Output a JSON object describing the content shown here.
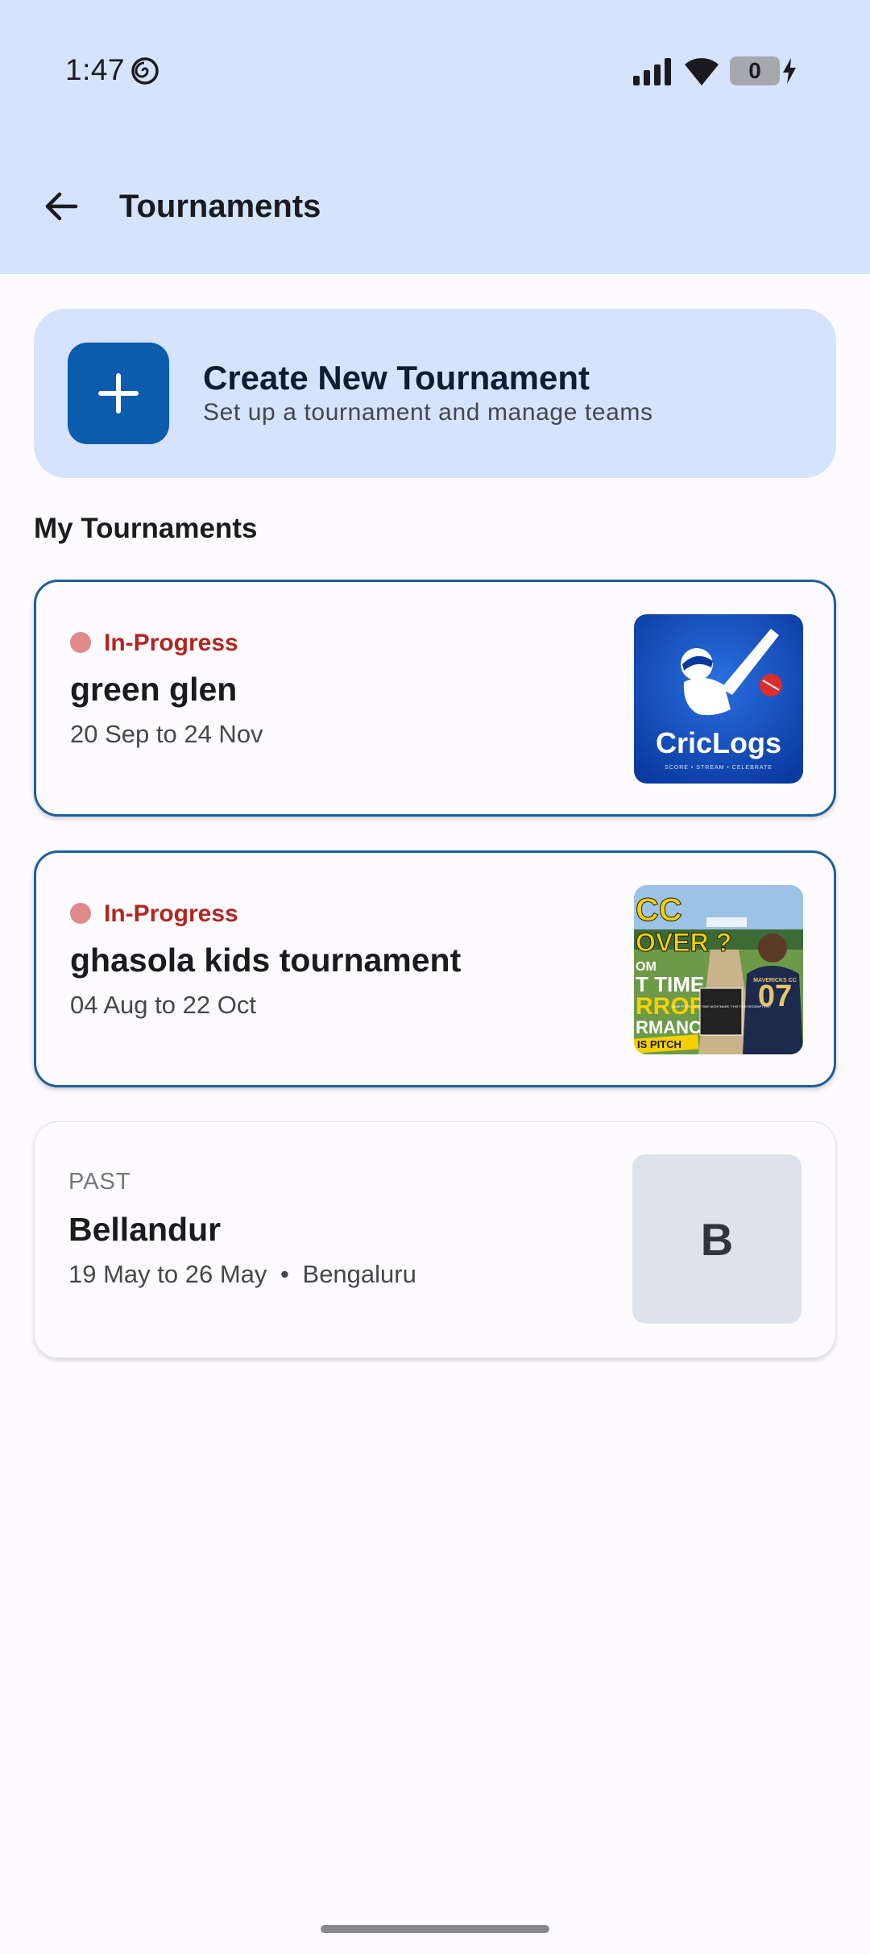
{
  "status_bar": {
    "time": "1:47",
    "battery": "0",
    "icons": [
      "spiral-icon",
      "signal-icon",
      "wifi-icon",
      "battery-icon",
      "charging-bolt-icon"
    ]
  },
  "header": {
    "title": "Tournaments",
    "back_icon": "arrow-left-icon",
    "background": "#d6e3fd"
  },
  "create": {
    "title": "Create New Tournament",
    "subtitle": "Set up a tournament and manage teams",
    "icon": "plus-icon",
    "accent": "#0b5cad"
  },
  "section_title": "My Tournaments",
  "tournaments": [
    {
      "status": "In-Progress",
      "name": "green glen",
      "dates": "20 Sep to 24 Nov",
      "thumbnail": {
        "type": "logo",
        "text": "CricLogs",
        "tagline": "SCORE • STREAM • CELEBRATE"
      }
    },
    {
      "status": "In-Progress",
      "name": "ghasola kids tournament",
      "dates": "04 Aug to 22 Oct",
      "thumbnail": {
        "type": "photo",
        "lines": [
          "CC",
          "OVER ?",
          "OM",
          "T TIME",
          "RROR",
          "RMANCE",
          "IS PITCH"
        ],
        "jersey": "07",
        "jersey_name": "MAVERICKS CC",
        "sign": "SAME PITCH. LAST TIME NIGHTMARE. THIS TIME REDEMPTION?"
      }
    },
    {
      "status": "PAST",
      "name": "Bellandur",
      "dates": "19 May to 26 May",
      "location": "Bengaluru",
      "separator": "•",
      "thumbnail": {
        "type": "initial",
        "text": "B"
      }
    }
  ],
  "colors": {
    "in_progress_text": "#b3261e",
    "in_progress_dot": "#e08a8a",
    "active_border": "#1d5f9c"
  }
}
